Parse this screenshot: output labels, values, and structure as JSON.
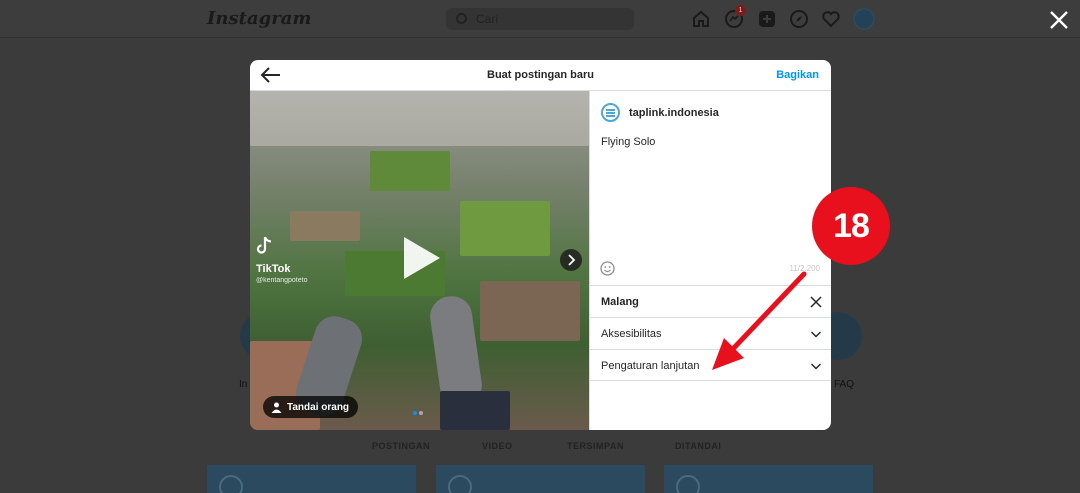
{
  "background": {
    "logo": "Instagram",
    "search_placeholder": "Cari",
    "notification_count": "1",
    "highlights": {
      "left_label": "In",
      "right_label": "FAQ"
    },
    "profile_tabs": [
      "POSTINGAN",
      "VIDEO",
      "TERSIMPAN",
      "DITANDAI"
    ]
  },
  "modal": {
    "title": "Buat postingan baru",
    "share_label": "Bagikan",
    "media": {
      "watermark_brand": "TikTok",
      "watermark_user": "@kentangpoteto",
      "tag_people_label": "Tandai orang",
      "carousel_dots": 2,
      "active_dot": 0
    },
    "account_name": "taplink.indonesia",
    "caption": "Flying Solo",
    "char_count": "11/2.200",
    "location": "Malang",
    "accessibility_label": "Aksesibilitas",
    "advanced_settings_label": "Pengaturan lanjutan"
  },
  "annotation": {
    "step_number": "18",
    "color": "#e8101c"
  },
  "colors": {
    "accent_blue": "#0095f6",
    "overlay": "#3b3b3b"
  },
  "icons": [
    "back-arrow-icon",
    "play-icon",
    "chevron-right-icon",
    "person-icon",
    "emoji-icon",
    "close-icon",
    "chevron-down-icon",
    "tiktok-icon",
    "home-icon",
    "messenger-icon",
    "new-post-icon",
    "explore-icon",
    "heart-icon",
    "search-icon"
  ]
}
